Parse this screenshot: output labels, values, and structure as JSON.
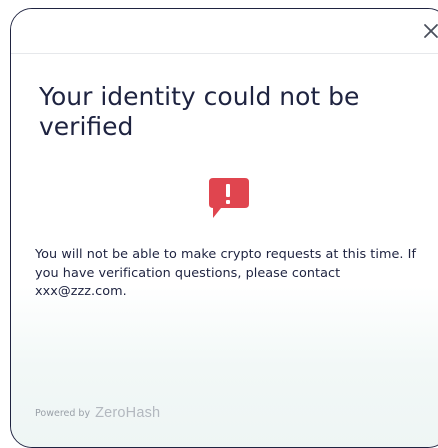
{
  "dialog": {
    "title": "Your identity could not be verified",
    "message": "You will not be able to make crypto requests at this time. If you have verification questions, please contact xxx@zzz.com.",
    "powered_by_label": "Powered by",
    "brand_logo_text": "ZeroHash",
    "close_icon": "close-icon",
    "alert_icon": "alert-chat-bubble-icon"
  },
  "colors": {
    "alert_red": "#e0454f",
    "text_dark": "#1e2340",
    "muted": "#9aa0a8"
  }
}
